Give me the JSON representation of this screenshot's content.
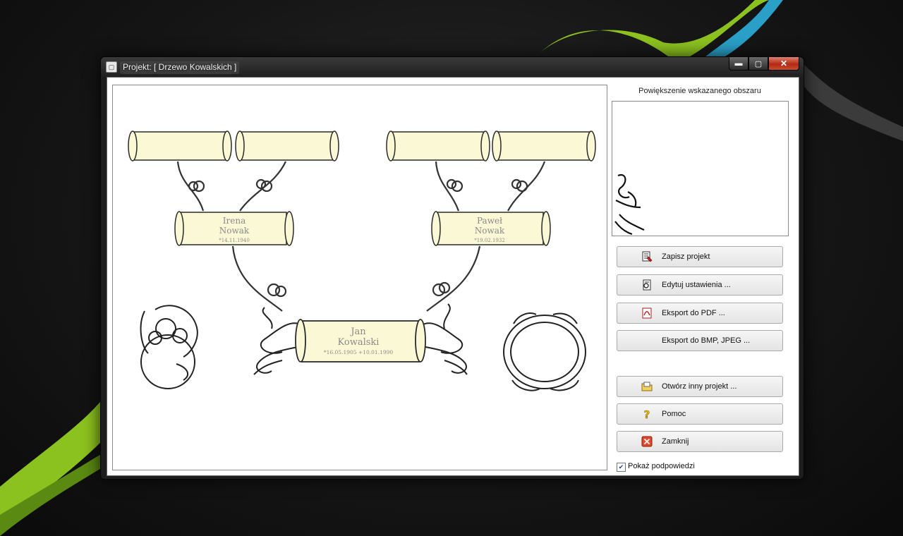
{
  "window": {
    "title": "Projekt: [ Drzewo Kowalskich ]",
    "caption_minimize": "▬",
    "caption_maximize": "▢",
    "caption_close": "✕"
  },
  "tree": {
    "grandparents": [
      {
        "first": "",
        "last": "",
        "dates": ""
      },
      {
        "first": "",
        "last": "",
        "dates": ""
      },
      {
        "first": "",
        "last": "",
        "dates": ""
      },
      {
        "first": "",
        "last": "",
        "dates": ""
      }
    ],
    "mother": {
      "first": "Irena",
      "last": "Nowak",
      "dates": "*14.11.1940"
    },
    "father": {
      "first": "Paweł",
      "last": "Nowak",
      "dates": "*19.02.1932"
    },
    "subject": {
      "first": "Jan",
      "last": "Kowalski",
      "dates": "*16.05.1905 +10.01.1990"
    }
  },
  "sidebar": {
    "preview_label": "Powiększenie wskazanego obszaru",
    "buttons": [
      {
        "label": "Zapisz projekt",
        "icon": "save-icon"
      },
      {
        "label": "Edytuj ustawienia ...",
        "icon": "settings-icon"
      },
      {
        "label": "Eksport do PDF ...",
        "icon": "pdf-icon"
      },
      {
        "label": "Eksport do BMP, JPEG ...",
        "icon": ""
      },
      {
        "label": "Otwórz inny projekt ...",
        "icon": "open-folder-icon"
      },
      {
        "label": "Pomoc",
        "icon": "help-icon"
      },
      {
        "label": "Zamknij",
        "icon": "close-red-icon"
      }
    ],
    "show_hints_label": "Pokaż podpowiedzi",
    "show_hints_checked": true
  },
  "colors": {
    "scroll_fill": "#fbf8d6",
    "scroll_ink": "#2a2a2a",
    "accent_green": "#8cc21f"
  }
}
